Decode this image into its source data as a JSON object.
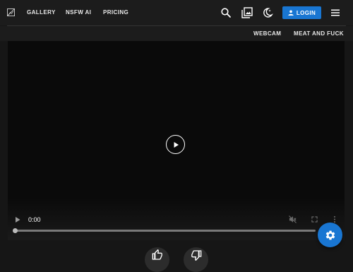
{
  "header": {
    "logo_icon": "broken-image-icon",
    "nav": [
      {
        "label": "GALLERY"
      },
      {
        "label": "NSFW AI"
      },
      {
        "label": "PRICING"
      }
    ],
    "icons": [
      "search-icon",
      "gallery-icon",
      "dark-mode-icon",
      "menu-icon"
    ],
    "login_label": "LOGIN",
    "login_icon": "person-icon"
  },
  "subnav": [
    {
      "label": "WEBCAM"
    },
    {
      "label": "MEAT AND FUCK"
    }
  ],
  "player": {
    "current_time": "0:00",
    "progress": 0,
    "controls": [
      "play-icon",
      "mute-icon",
      "fullscreen-icon",
      "more-options-icon"
    ]
  },
  "actions": [
    "like-icon",
    "dislike-icon"
  ],
  "fab_icon": "settings-icon",
  "colors": {
    "accent": "#1976d2",
    "background": "#161616",
    "bar": "#1c1c1c"
  }
}
